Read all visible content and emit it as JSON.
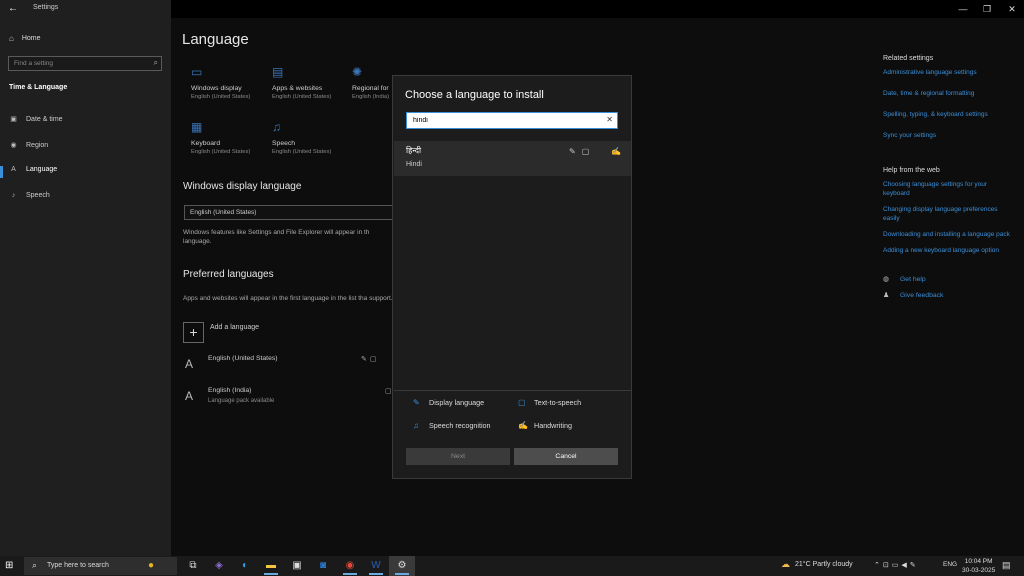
{
  "window": {
    "title": "Settings",
    "back_icon": "←",
    "minimize": "—",
    "maximize": "❐",
    "close": "✕"
  },
  "sidebar": {
    "home": "Home",
    "search_placeholder": "Find a setting",
    "section": "Time & Language",
    "items": [
      {
        "label": "Date & time",
        "icon": "calendar-clock-icon"
      },
      {
        "label": "Region",
        "icon": "globe-icon"
      },
      {
        "label": "Language",
        "icon": "language-icon"
      },
      {
        "label": "Speech",
        "icon": "microphone-icon"
      }
    ],
    "active_index": 2
  },
  "main": {
    "title": "Language",
    "tiles": [
      {
        "name": "Windows display",
        "sub": "English (United States)",
        "icon": "monitor-icon"
      },
      {
        "name": "Apps & websites",
        "sub": "English (United States)",
        "icon": "browser-window-icon"
      },
      {
        "name": "Regional for",
        "sub": "English (India)",
        "icon": "regional-format-icon"
      },
      {
        "name": "Keyboard",
        "sub": "English (United States)",
        "icon": "keyboard-icon"
      },
      {
        "name": "Speech",
        "sub": "English (United States)",
        "icon": "microphone-icon"
      }
    ],
    "display_heading": "Windows display language",
    "display_value": "English (United States)",
    "display_note": "Windows features like Settings and File Explorer will appear in th language.",
    "preferred_heading": "Preferred languages",
    "preferred_note": "Apps and websites will appear in the first language in the list tha support.",
    "add_language": "Add a language",
    "languages": [
      {
        "name": "English (United States)",
        "sub": ""
      },
      {
        "name": "English (India)",
        "sub": "Language pack available"
      }
    ]
  },
  "right_rail": {
    "related_heading": "Related settings",
    "related_links": [
      "Administrative language settings",
      "Date, time & regional formatting",
      "Spelling, typing, & keyboard settings",
      "Sync your settings"
    ],
    "help_heading": "Help from the web",
    "help_links": [
      "Choosing language settings for your keyboard",
      "Changing display language preferences easily",
      "Downloading and installing a language pack",
      "Adding a new keyboard language option"
    ],
    "get_help": "Get help",
    "give_feedback": "Give feedback"
  },
  "dialog": {
    "title": "Choose a language to install",
    "search_value": "hindi",
    "clear_icon": "✕",
    "result": {
      "native": "हिन्दी",
      "english": "Hindi"
    },
    "legend": {
      "display_language": "Display language",
      "text_to_speech": "Text-to-speech",
      "speech_recognition": "Speech recognition",
      "handwriting": "Handwriting"
    },
    "next": "Next",
    "cancel": "Cancel"
  },
  "taskbar": {
    "search_text": "Type here to search",
    "weather": "21°C  Partly cloudy",
    "language": "ENG",
    "time": "10:04 PM",
    "date": "30-03-2025"
  },
  "colors": {
    "accent": "#3a8fd9",
    "dialog_bg": "#1c1c1c",
    "sidebar_bg": "#1f1f1f"
  }
}
